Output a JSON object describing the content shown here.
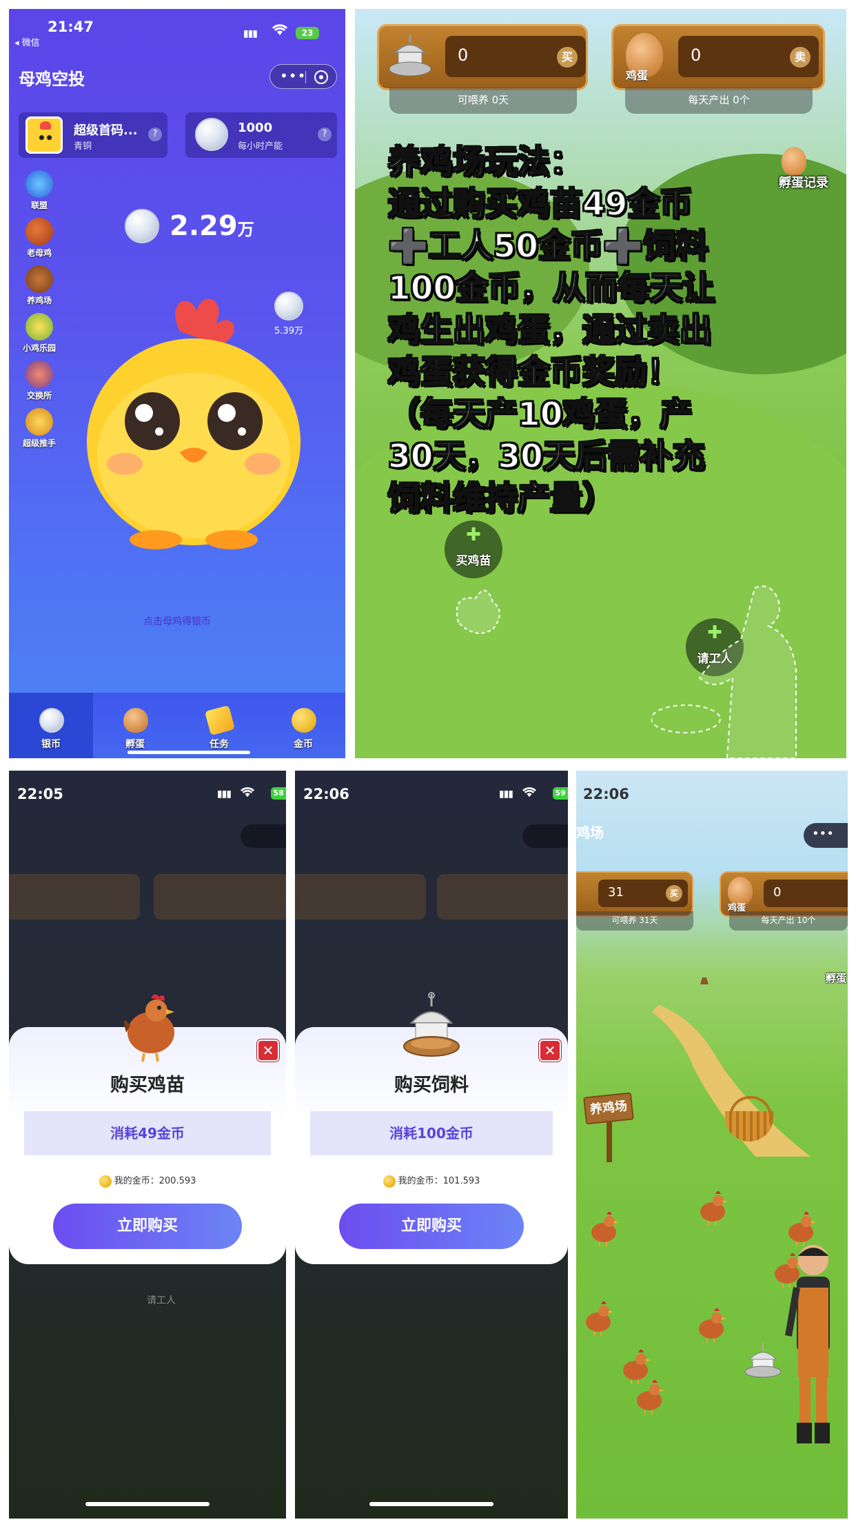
{
  "panel_a": {
    "status": {
      "time": "21:47",
      "back_label": "◂ 微信",
      "battery": "23"
    },
    "title": "母鸡空投",
    "user_card": {
      "name": "超级首码...",
      "level": "青铜",
      "help": "?"
    },
    "rate_card": {
      "value": "1000",
      "label": "每小时产能",
      "help": "?"
    },
    "side_menu": [
      {
        "label": "联盟",
        "icon": "super-badge-icon"
      },
      {
        "label": "老母鸡",
        "icon": "hen-icon"
      },
      {
        "label": "养鸡场",
        "icon": "chicken-coop-icon"
      },
      {
        "label": "小鸡乐园",
        "icon": "chick-park-icon"
      },
      {
        "label": "交换所",
        "icon": "exchange-shop-icon"
      },
      {
        "label": "超级推手",
        "icon": "trophy-icon"
      }
    ],
    "balance": {
      "value": "2.29",
      "unit": "万"
    },
    "bubble": {
      "value": "5.39万"
    },
    "hint": "点击母鸡得银币",
    "tabs": [
      {
        "label": "银币",
        "selected": true,
        "icon": "silver-coin-icon"
      },
      {
        "label": "孵蛋",
        "selected": false,
        "icon": "egg-icon"
      },
      {
        "label": "任务",
        "selected": false,
        "icon": "task-ticket-icon"
      },
      {
        "label": "金币",
        "selected": false,
        "icon": "gold-coin-icon"
      }
    ]
  },
  "panel_b": {
    "feed_box": {
      "value": "0",
      "button": "买",
      "caption": "可喂养 0天"
    },
    "egg_box": {
      "label": "鸡蛋",
      "value": "0",
      "button": "卖",
      "caption": "每天产出 0个"
    },
    "hatch_record": "孵蛋记录",
    "overlay_text": [
      "养鸡场玩法：",
      "通过购买鸡苗49金币",
      "➕工人50金币➕饲料",
      "100金币，从而每天让",
      "鸡生出鸡蛋，通过卖出",
      "鸡蛋获得金币奖励！",
      "（每天产10鸡蛋，产",
      "30天，30天后需补充",
      "饲料维持产量）"
    ],
    "buy_chick": "买鸡苗",
    "hire_worker": "请工人"
  },
  "panel_c": {
    "status": {
      "time": "22:05",
      "battery": "58"
    },
    "modal": {
      "title": "购买鸡苗",
      "cost": "消耗49金币",
      "my_coins_label": "我的金币：",
      "my_coins": "200.593",
      "buy": "立即购买",
      "close": "✕"
    },
    "ghost_worker": "请工人"
  },
  "panel_d": {
    "status": {
      "time": "22:06",
      "battery": "59"
    },
    "modal": {
      "title": "购买饲料",
      "cost": "消耗100金币",
      "my_coins_label": "我的金币：",
      "my_coins": "101.593",
      "buy": "立即购买",
      "close": "✕"
    }
  },
  "panel_e": {
    "status": {
      "time": "22:06"
    },
    "title": "鸡场",
    "feed_box": {
      "value": "31",
      "button": "买",
      "caption": "可喂养 31天"
    },
    "egg_box": {
      "label": "鸡蛋",
      "value": "0",
      "caption": "每天产出 10个"
    },
    "hatch": "孵蛋",
    "sign": "养鸡场"
  },
  "colors": {
    "primary_purple": "#5b45e8",
    "button_gradient_start": "#6c4df0",
    "wood": "#9a5f1c",
    "grass": "#7ec543"
  }
}
